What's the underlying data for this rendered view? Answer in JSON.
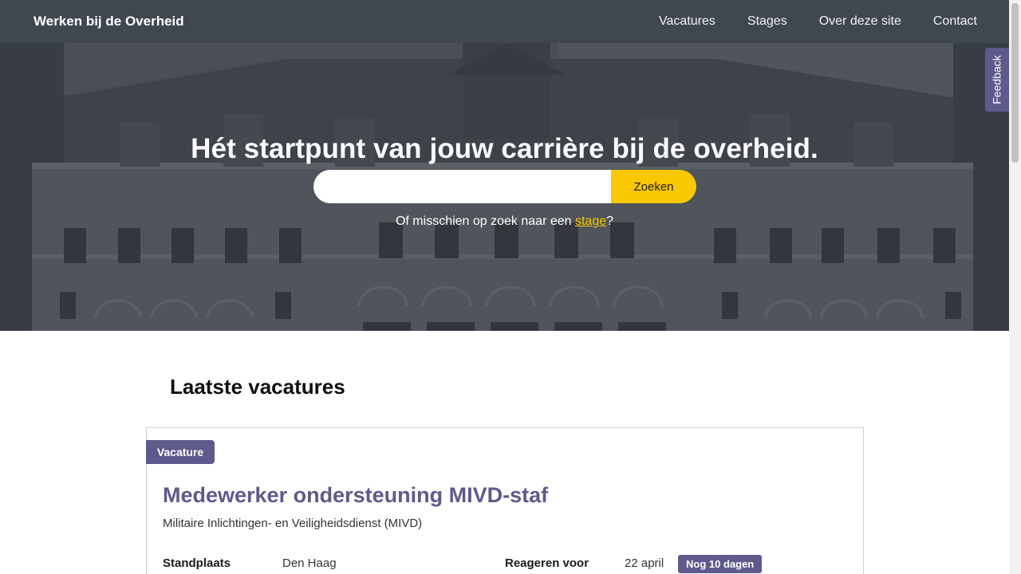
{
  "header": {
    "brand": "Werken bij de Overheid",
    "nav": [
      "Vacatures",
      "Stages",
      "Over deze site",
      "Contact"
    ]
  },
  "hero": {
    "title": "Hét startpunt van jouw carrière bij de overheid.",
    "search_placeholder": "",
    "search_button": "Zoeken",
    "sub_prefix": "Of misschien op zoek naar een ",
    "sub_link": "stage",
    "sub_suffix": "?"
  },
  "feedback": {
    "label": "Feedback"
  },
  "section": {
    "title": "Laatste vacatures"
  },
  "vacancy": {
    "tag": "Vacature",
    "title": "Medewerker ondersteuning MIVD-staf",
    "organisation": "Militaire Inlichtingen- en Veiligheidsdienst (MIVD)",
    "location_label": "Standplaats",
    "location_value": "Den Haag",
    "deadline_label": "Reageren voor",
    "deadline_value": "22 april",
    "days_left": "Nog 10 dagen"
  },
  "colors": {
    "topbar": "#3f4750",
    "accent_purple": "#5f5a8c",
    "accent_yellow": "#f9c800"
  }
}
